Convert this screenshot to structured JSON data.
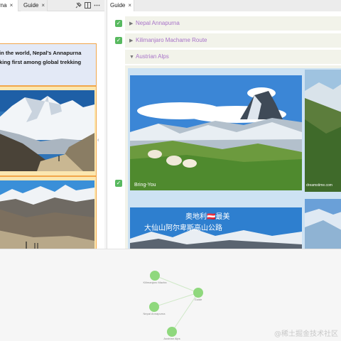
{
  "left_pane": {
    "tabs": [
      {
        "label": "rna",
        "close": "×"
      },
      {
        "label": "Guide",
        "close": "×"
      }
    ],
    "quote_lines": [
      "in the world, Nepal's Annapurna",
      "king first among global trekking"
    ],
    "collapse_glyph": "‹"
  },
  "right_pane": {
    "tabs": [
      {
        "label": "Guide",
        "close": "×"
      }
    ],
    "sections": [
      {
        "title": "Nepal Annapurna",
        "arrow": "▶",
        "checked": true
      },
      {
        "title": "Kilimanjaro Machame Route",
        "arrow": "▶",
        "checked": true
      },
      {
        "title": "Austrian Alps",
        "arrow": "▼",
        "checked": true
      }
    ],
    "check_glyph": "✓",
    "images": {
      "matterhorn_caption": "Bring-You",
      "dreamstime_caption": "dreamstime.com",
      "banner_line1": "奥地利🇦🇹最美",
      "banner_line2": "大仙山阿尔卑斯高山公路"
    }
  },
  "graph": {
    "nodes": [
      {
        "label": "Kilimanjaro Macha"
      },
      {
        "label": "Guide"
      },
      {
        "label": "Nepal Annapurna"
      },
      {
        "label": "Austrian Alps"
      }
    ]
  },
  "watermark": "@稀土掘金技术社区",
  "colors": {
    "accent": "#a873c8",
    "check": "#58b95f",
    "node": "#8fd87d",
    "border": "#f2a64a"
  }
}
